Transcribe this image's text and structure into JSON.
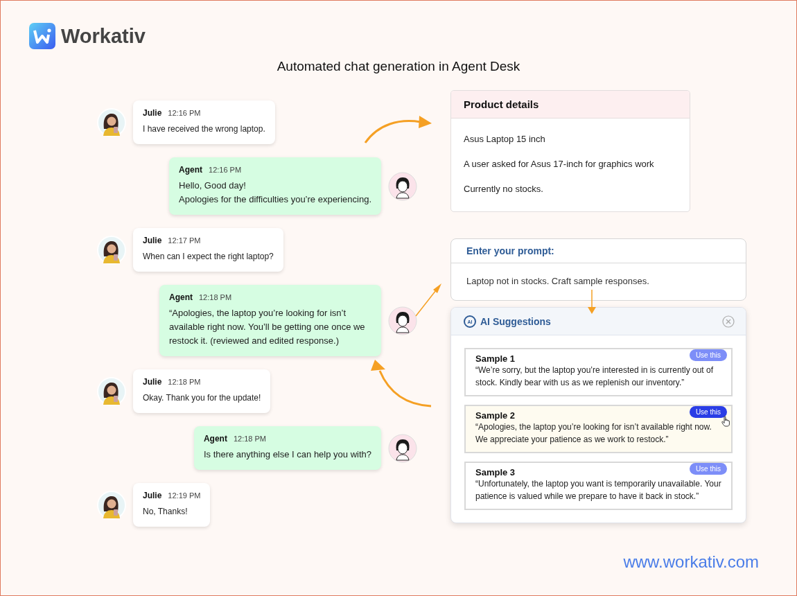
{
  "brand": {
    "name": "Workativ"
  },
  "title": "Automated chat generation in Agent Desk",
  "chat": [
    {
      "kind": "user",
      "sender": "Julie",
      "time": "12:16 PM",
      "lines": [
        "I have received the wrong laptop."
      ]
    },
    {
      "kind": "agent",
      "sender": "Agent",
      "time": "12:16 PM",
      "lines": [
        "Hello, Good day!",
        "Apologies for the difficulties you’re experiencing."
      ]
    },
    {
      "kind": "user",
      "sender": "Julie",
      "time": "12:17 PM",
      "lines": [
        "When can I expect the right laptop?"
      ]
    },
    {
      "kind": "agent",
      "sender": "Agent",
      "time": "12:18 PM",
      "lines": [
        "“Apologies, the laptop you’re looking for isn’t available right now. You’ll be getting one once we restock it. (reviewed and edited response.)"
      ]
    },
    {
      "kind": "user",
      "sender": "Julie",
      "time": "12:18 PM",
      "lines": [
        "Okay. Thank you for the update!"
      ]
    },
    {
      "kind": "agent",
      "sender": "Agent",
      "time": "12:18 PM",
      "lines": [
        "Is there anything else I can help you with?"
      ]
    },
    {
      "kind": "user",
      "sender": "Julie",
      "time": "12:19 PM",
      "lines": [
        "No, Thanks!"
      ]
    }
  ],
  "product_details": {
    "title": "Product details",
    "items": [
      "Asus Laptop 15 inch",
      "A user asked for Asus 17-inch for graphics work",
      "Currently no stocks."
    ]
  },
  "prompt": {
    "title": "Enter your prompt:",
    "value": "Laptop not in stocks. Craft sample responses."
  },
  "suggestions": {
    "icon_text": "AI",
    "title": "AI Suggestions",
    "samples": [
      {
        "title": "Sample 1",
        "button": "Use this",
        "text": "“We’re sorry, but the laptop you’re interested in is currently out of stock. Kindly bear with us as we replenish our inventory.”",
        "selected": false
      },
      {
        "title": "Sample 2",
        "button": "Use this",
        "text": "“Apologies, the laptop you’re looking for isn’t available right now. We appreciate your patience as we work to restock.”",
        "selected": true
      },
      {
        "title": "Sample 3",
        "button": "Use this",
        "text": "“Unfortunately, the laptop you want is temporarily unavailable. Your patience is valued while we prepare to have it back in stock.”",
        "selected": false
      }
    ]
  },
  "footer": {
    "url": "www.workativ.com"
  }
}
